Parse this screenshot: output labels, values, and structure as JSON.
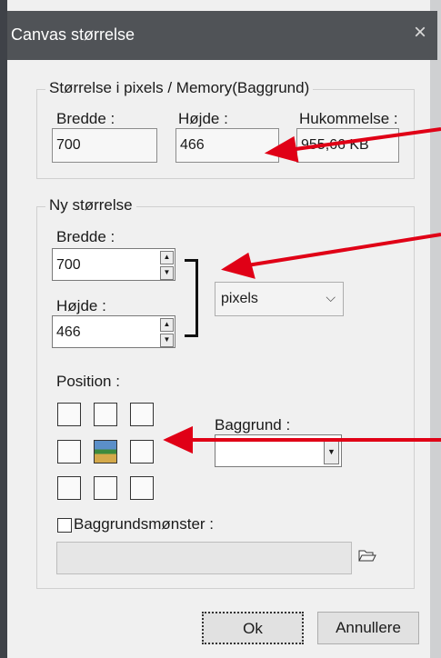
{
  "window": {
    "title": "Canvas størrelse",
    "close_icon": "×"
  },
  "size_group": {
    "legend": "Størrelse i pixels / Memory(Baggrund)",
    "width_label": "Bredde :",
    "width_value": "700",
    "height_label": "Højde :",
    "height_value": "466",
    "memory_label": "Hukommelse :",
    "memory_value": "955,66 KB"
  },
  "new_size_group": {
    "legend": "Ny størrelse",
    "width_label": "Bredde :",
    "width_value": "700",
    "height_label": "Højde :",
    "height_value": "466",
    "unit_value": "pixels",
    "position_label": "Position :",
    "background_label": "Baggrund :",
    "background_value": "",
    "pattern_label": "Baggrundsmønster :",
    "pattern_path": ""
  },
  "buttons": {
    "ok": "Ok",
    "cancel": "Annullere"
  },
  "colors": {
    "arrow": "#e00016",
    "titlebar": "#505357"
  }
}
